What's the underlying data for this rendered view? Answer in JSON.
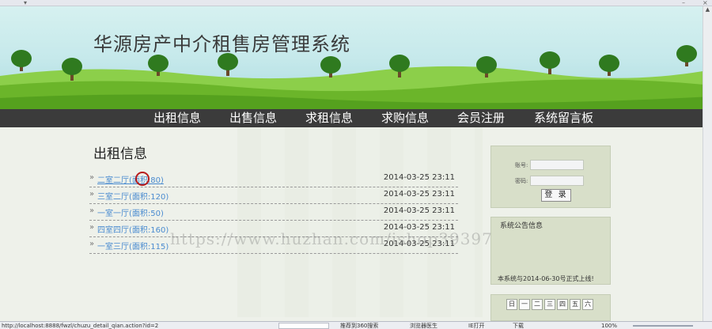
{
  "site_title": "华源房产中介租售房管理系统",
  "nav": [
    {
      "label": "出租信息"
    },
    {
      "label": "出售信息"
    },
    {
      "label": "求租信息"
    },
    {
      "label": "求购信息"
    },
    {
      "label": "会员注册"
    },
    {
      "label": "系统留言板"
    }
  ],
  "section_title": "出租信息",
  "list_arrow": "»",
  "listings": [
    {
      "title": "二室二厅(面积:80)",
      "date": "2014-03-25 23:11"
    },
    {
      "title": "三室二厅(面积:120)",
      "date": "2014-03-25 23:11"
    },
    {
      "title": "一室一厅(面积:50)",
      "date": "2014-03-25 23:11"
    },
    {
      "title": "四室四厅(面积:160)",
      "date": "2014-03-25 23:11"
    },
    {
      "title": "一室三厅(面积:115)",
      "date": "2014-03-25 23:11"
    }
  ],
  "login": {
    "account_label": "账号:",
    "password_label": "密码:",
    "login_button": "登 录"
  },
  "notice": {
    "title": "系统公告信息",
    "text": "本系统与2014-06-30号正式上线!"
  },
  "calendar": {
    "weekdays": [
      "日",
      "一",
      "二",
      "三",
      "四",
      "五",
      "六"
    ]
  },
  "watermark": "https://www.huzhan.com/ishop39397",
  "statusbar": {
    "url": "http://localhost:8888/fwzl/chuzu_detail_qian.action?id=2",
    "recommend": "推荐到360搜索",
    "doctor": "浏览器医生",
    "ie": "IE打开",
    "download": "下载",
    "zoom": "100%"
  },
  "colors": {
    "nav_bg": "#3b3b3b",
    "link": "#4a8bd0",
    "panel_bg": "#d8dfc9",
    "grass": "#6bb52a",
    "sky": "#c6e9eb"
  }
}
